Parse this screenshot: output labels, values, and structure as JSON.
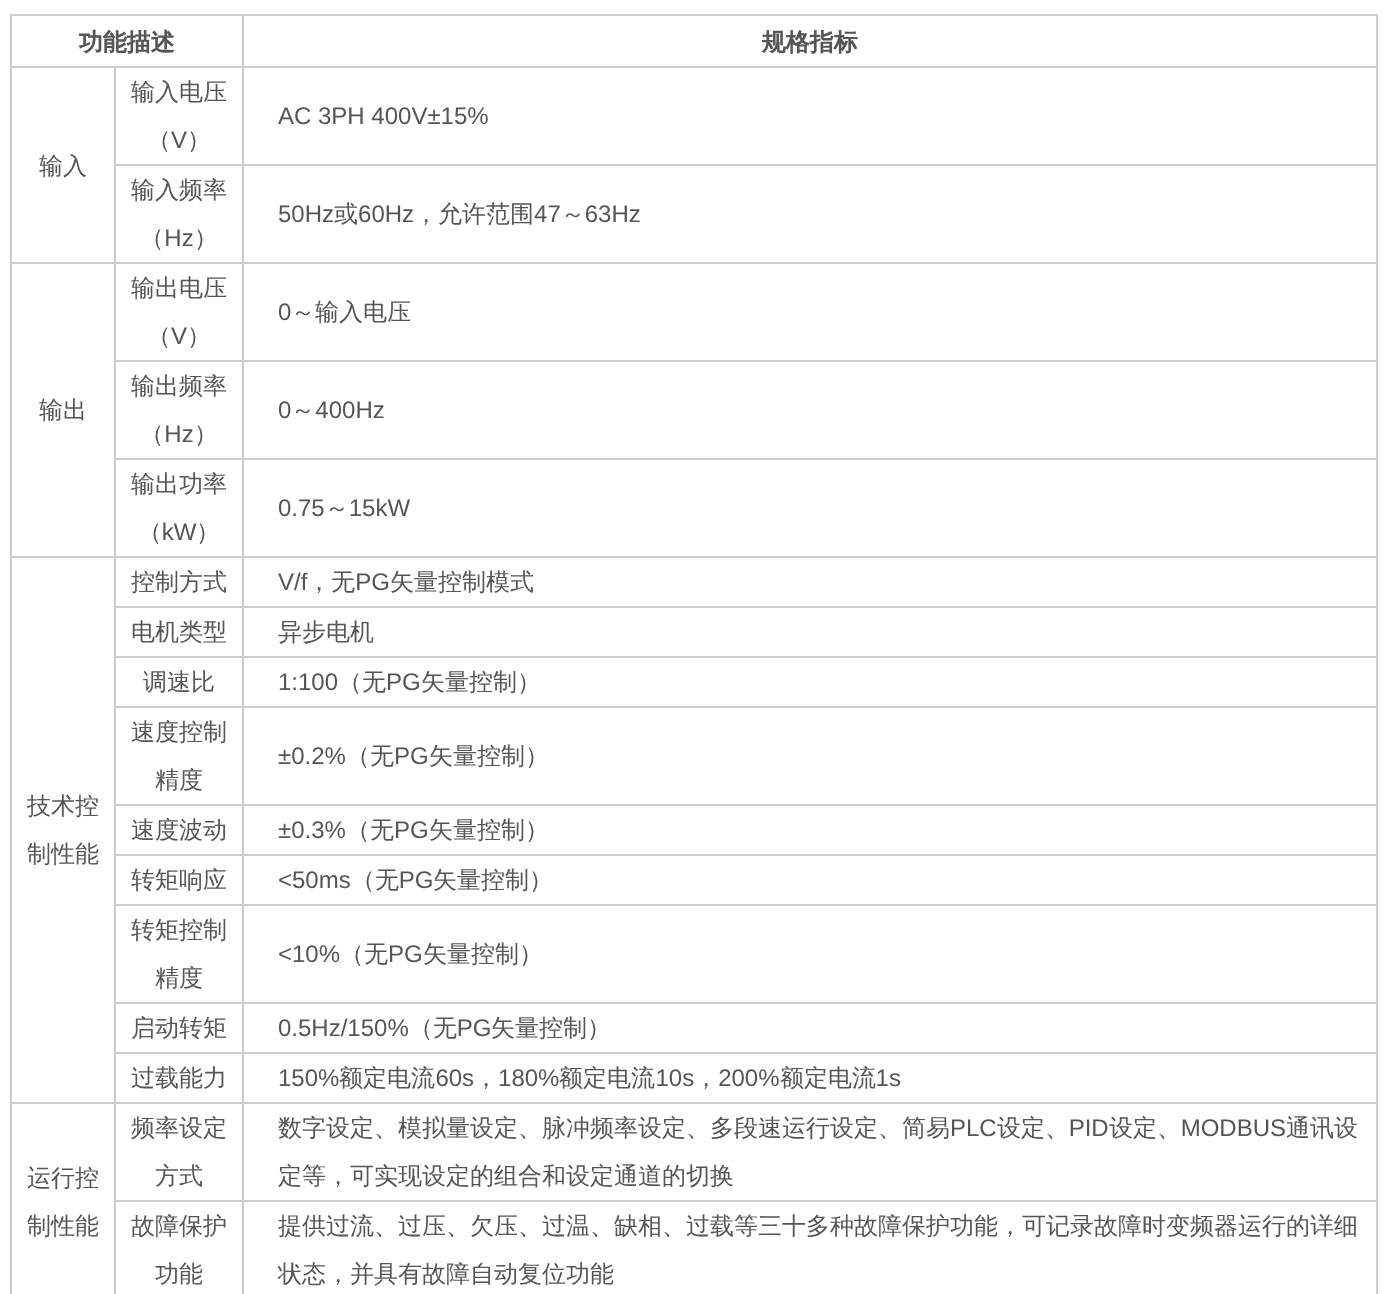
{
  "header": {
    "column_1": "功能描述",
    "column_2": "规格指标"
  },
  "groups": [
    {
      "label": "输入",
      "items": [
        {
          "name": "输入电压（V）",
          "value": "AC 3PH 400V±15%"
        },
        {
          "name": "输入频率（Hz）",
          "value": "50Hz或60Hz，允许范围47～63Hz"
        }
      ]
    },
    {
      "label": "输出",
      "items": [
        {
          "name": "输出电压（V）",
          "value": "0～输入电压"
        },
        {
          "name": "输出频率（Hz）",
          "value": "0～400Hz"
        },
        {
          "name": "输出功率（kW）",
          "value": "0.75～15kW"
        }
      ]
    },
    {
      "label": "技术控制性能",
      "items": [
        {
          "name": "控制方式",
          "value": "V/f，无PG矢量控制模式"
        },
        {
          "name": "电机类型",
          "value": "异步电机"
        },
        {
          "name": "调速比",
          "value": "1:100（无PG矢量控制）"
        },
        {
          "name": "速度控制精度",
          "value": "±0.2%（无PG矢量控制）"
        },
        {
          "name": "速度波动",
          "value": "±0.3%（无PG矢量控制）"
        },
        {
          "name": "转矩响应",
          "value": "<50ms（无PG矢量控制）"
        },
        {
          "name": "转矩控制精度",
          "value": "<10%（无PG矢量控制）"
        },
        {
          "name": "启动转矩",
          "value": "0.5Hz/150%（无PG矢量控制）"
        },
        {
          "name": "过载能力",
          "value": "150%额定电流60s，180%额定电流10s，200%额定电流1s"
        }
      ]
    },
    {
      "label": "运行控制性能",
      "items": [
        {
          "name": "频率设定方式",
          "value": "数字设定、模拟量设定、脉冲频率设定、多段速运行设定、简易PLC设定、PID设定、MODBUS通讯设定等，可实现设定的组合和设定通道的切换"
        },
        {
          "name": "故障保护功能",
          "value": "提供过流、过压、欠压、过温、缺相、过载等三十多种故障保护功能，可记录故障时变频器运行的详细状态，并具有故障自动复位功能"
        }
      ]
    }
  ]
}
